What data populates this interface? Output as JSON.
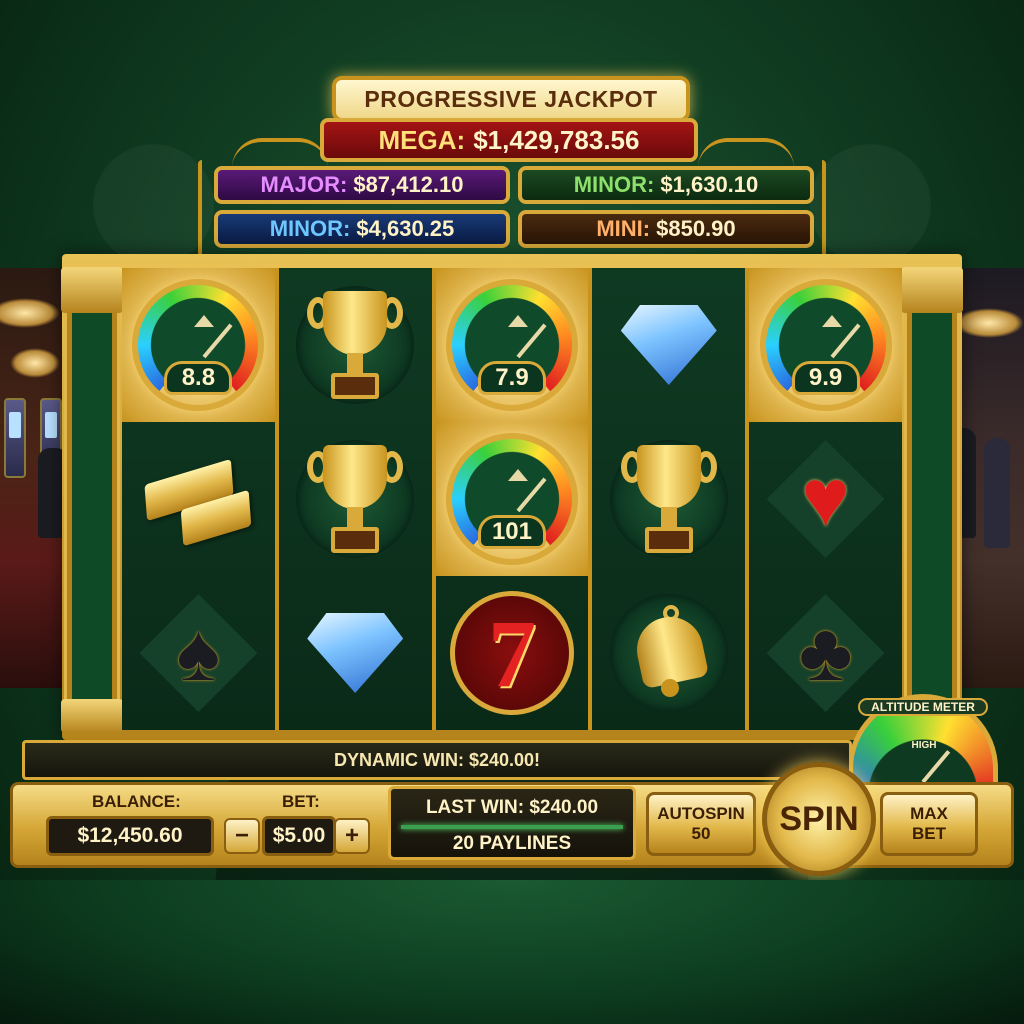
{
  "jackpot": {
    "title": "PROGRESSIVE JACKPOT",
    "mega": {
      "label": "MEGA:",
      "value": "$1,429,783.56"
    },
    "major": {
      "label": "MAJOR:",
      "value": "$87,412.10"
    },
    "minor_green": {
      "label": "MINOR:",
      "value": "$1,630.10"
    },
    "minor_blue": {
      "label": "MINOR:",
      "value": "$4,630.25"
    },
    "mini": {
      "label": "MINI:",
      "value": "$850.90"
    }
  },
  "reels": [
    [
      {
        "symbol": "altitude-gauge",
        "value": "8.8",
        "lit": true
      },
      {
        "symbol": "gold-bars",
        "text": "GOLD BAR"
      },
      {
        "symbol": "spade"
      }
    ],
    [
      {
        "symbol": "trophy"
      },
      {
        "symbol": "trophy"
      },
      {
        "symbol": "diamond"
      }
    ],
    [
      {
        "symbol": "altitude-gauge",
        "value": "7.9",
        "lit": true
      },
      {
        "symbol": "altitude-gauge",
        "value": "101",
        "lit": true
      },
      {
        "symbol": "seven",
        "text": "7"
      }
    ],
    [
      {
        "symbol": "diamond"
      },
      {
        "symbol": "trophy"
      },
      {
        "symbol": "bell"
      }
    ],
    [
      {
        "symbol": "altitude-gauge",
        "value": "9.9",
        "lit": true
      },
      {
        "symbol": "heart"
      },
      {
        "symbol": "club"
      }
    ]
  ],
  "win_banner": "DYNAMIC WIN: $240.00!",
  "controls": {
    "balance_label": "BALANCE:",
    "balance_value": "$12,450.60",
    "bet_label": "BET:",
    "bet_value": "$5.00",
    "bet_minus": "−",
    "bet_plus": "+",
    "last_win": "LAST WIN: $240.00",
    "paylines": "20 PAYLINES",
    "autospin_label": "AUTOSPIN",
    "autospin_count": "50",
    "spin_label": "SPIN",
    "max_bet_line1": "MAX",
    "max_bet_line2": "BET"
  },
  "altitude_meter": {
    "title": "ALTITUDE METER",
    "level_label": "HIGH"
  },
  "colors": {
    "felt": "#0f3a20",
    "gold": "#d9a93a",
    "mega_red": "#a41414"
  }
}
